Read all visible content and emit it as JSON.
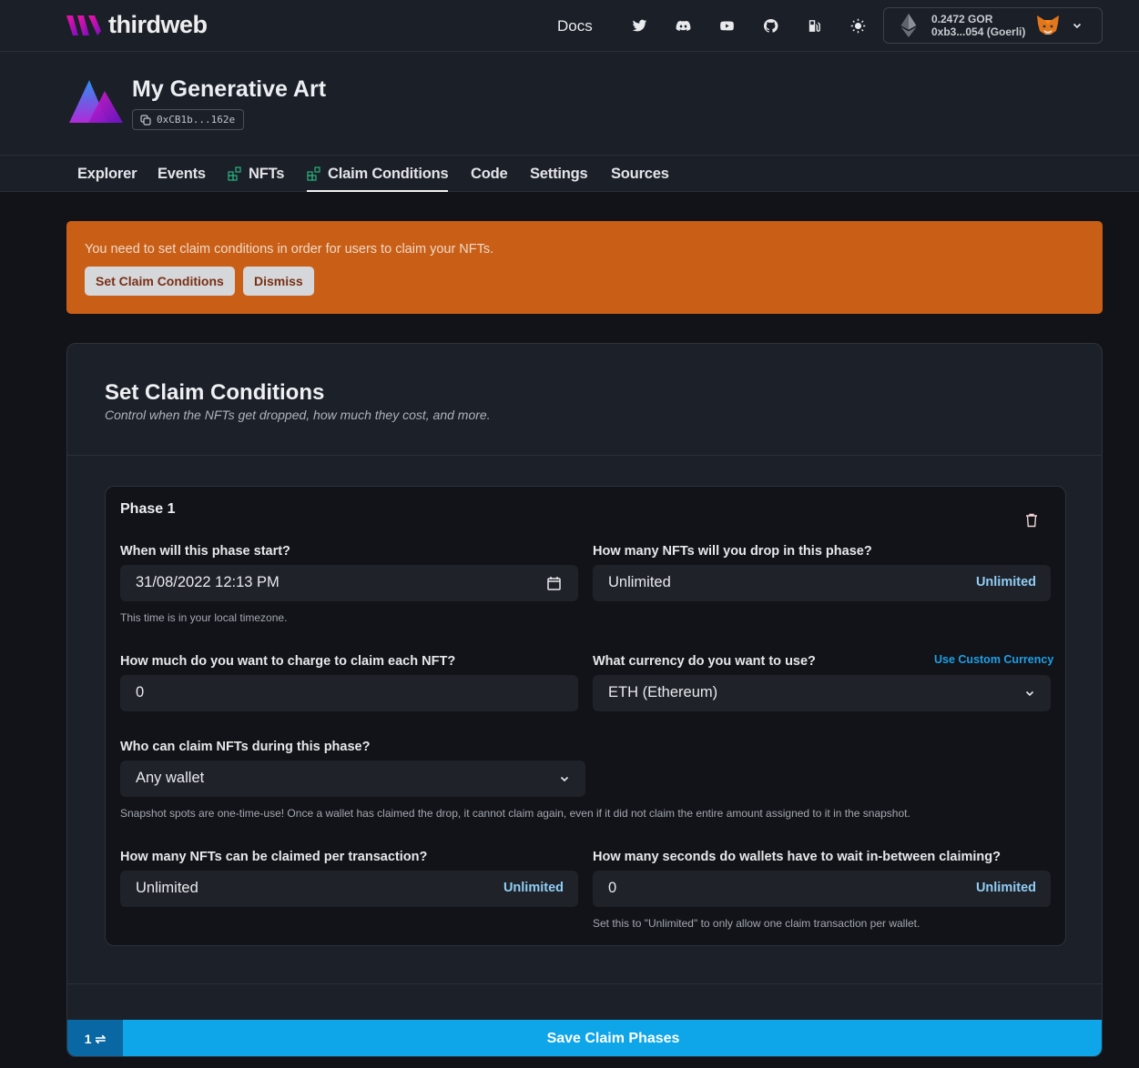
{
  "header": {
    "brand": "thirdweb",
    "docs_label": "Docs",
    "icons": [
      "twitter-icon",
      "discord-icon",
      "youtube-icon",
      "github-icon",
      "gas-pump-icon",
      "sun-icon"
    ],
    "wallet": {
      "balance": "0.2472 GOR",
      "address": "0xb3...054 (Goerli)"
    }
  },
  "contract": {
    "name": "My Generative Art",
    "address": "0xCB1b...162e"
  },
  "tabs": [
    {
      "label": "Explorer",
      "icon": null,
      "active": false
    },
    {
      "label": "Events",
      "icon": null,
      "active": false
    },
    {
      "label": "NFTs",
      "icon": "extension-icon",
      "active": false
    },
    {
      "label": "Claim Conditions",
      "icon": "extension-icon",
      "active": true
    },
    {
      "label": "Code",
      "icon": null,
      "active": false
    },
    {
      "label": "Settings",
      "icon": null,
      "active": false
    },
    {
      "label": "Sources",
      "icon": null,
      "active": false
    }
  ],
  "alert": {
    "message": "You need to set claim conditions in order for users to claim your NFTs.",
    "primary_label": "Set Claim Conditions",
    "secondary_label": "Dismiss",
    "color": "#c95f17"
  },
  "claim": {
    "title": "Set Claim Conditions",
    "subtitle": "Control when the NFTs get dropped, how much they cost, and more.",
    "phase": {
      "title": "Phase 1",
      "start": {
        "label": "When will this phase start?",
        "value": "31/08/2022 12:13  PM",
        "help": "This time is in your local timezone."
      },
      "drop_amount": {
        "label": "How many NFTs will you drop in this phase?",
        "value": "Unlimited",
        "addon": "Unlimited"
      },
      "price": {
        "label": "How much do you want to charge to claim each NFT?",
        "value": "0"
      },
      "currency": {
        "label": "What currency do you want to use?",
        "custom_link": "Use Custom Currency",
        "value": "ETH (Ethereum)"
      },
      "who_can_claim": {
        "label": "Who can claim NFTs during this phase?",
        "value": "Any wallet",
        "help": "Snapshot spots are one-time-use! Once a wallet has claimed the drop, it cannot claim again, even if it did not claim the entire amount assigned to it in the snapshot."
      },
      "per_tx": {
        "label": "How many NFTs can be claimed per transaction?",
        "value": "Unlimited",
        "addon": "Unlimited"
      },
      "wait_seconds": {
        "label": "How many seconds do wallets have to wait in-between claiming?",
        "value": "0",
        "addon": "Unlimited",
        "help": "Set this to \"Unlimited\" to only allow one claim transaction per wallet."
      }
    },
    "footer": {
      "phase_count": "1",
      "save_label": "Save Claim Phases",
      "accent": "#0ea5e9"
    }
  }
}
